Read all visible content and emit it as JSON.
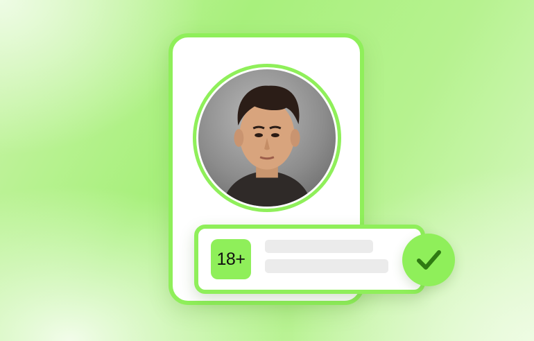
{
  "colors": {
    "accent": "#8fef5a",
    "card_background": "#ffffff",
    "placeholder_line": "#ebebeb",
    "check_mark": "#2f7a12"
  },
  "verification": {
    "age_label": "18+",
    "status": "verified"
  },
  "icons": {
    "profile_photo": "user-portrait-icon",
    "status": "checkmark-icon"
  }
}
